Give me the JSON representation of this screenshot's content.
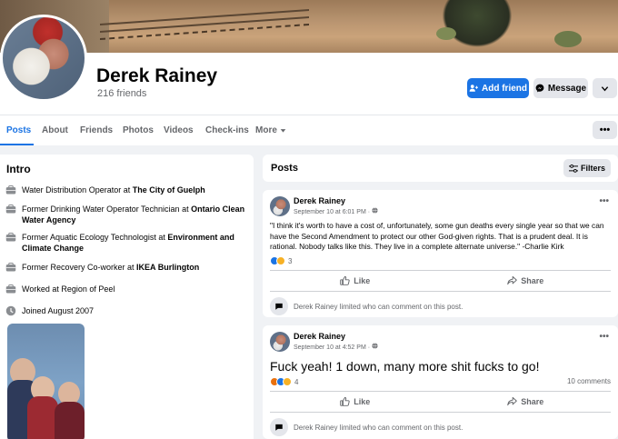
{
  "profile": {
    "name": "Derek Rainey",
    "friends_count": "216 friends"
  },
  "actions": {
    "add_friend": "Add friend",
    "message": "Message"
  },
  "tabs": [
    {
      "label": "Posts"
    },
    {
      "label": "About"
    },
    {
      "label": "Friends"
    },
    {
      "label": "Photos"
    },
    {
      "label": "Videos"
    },
    {
      "label": "Check-ins"
    },
    {
      "label": "More"
    }
  ],
  "intro": {
    "title": "Intro",
    "items": [
      {
        "pre": "Water Distribution Operator at ",
        "bold": "The City of Guelph",
        "icon": "briefcase-icon"
      },
      {
        "pre": "Former Drinking Water Operator Technician at ",
        "bold": "Ontario Clean Water Agency",
        "icon": "briefcase-icon"
      },
      {
        "pre": "Former Aquatic Ecology Technologist at ",
        "bold": "Environment and Climate Change",
        "icon": "briefcase-icon"
      },
      {
        "pre": "Former Recovery Co-worker at ",
        "bold": "IKEA Burlington",
        "icon": "briefcase-icon"
      },
      {
        "pre": "Worked at Region of Peel",
        "bold": "",
        "icon": "briefcase-icon"
      },
      {
        "pre": "Joined August 2007",
        "bold": "",
        "icon": "clock-icon"
      }
    ]
  },
  "posts_header": {
    "title": "Posts",
    "filters_label": "Filters"
  },
  "posts": [
    {
      "author": "Derek Rainey",
      "date": "September 10 at 6:01 PM · ",
      "text": "\"I think it's worth to have a cost of, unfortunately, some gun deaths every single year so that we can have the Second Amendment to protect our other God-given rights. That is a prudent deal. It is rational. Nobody talks like this. They live in a complete alternate universe.\" -Charlie Kirk",
      "reaction_count": "3",
      "comments": "",
      "like_label": "Like",
      "share_label": "Share",
      "limited_text": "Derek Rainey limited who can comment on this post."
    },
    {
      "author": "Derek Rainey",
      "date": "September 10 at 4:52 PM · ",
      "text": "Fuck yeah! 1 down, many more shit fucks to go!",
      "reaction_count": "4",
      "comments": "10 comments",
      "like_label": "Like",
      "share_label": "Share",
      "limited_text": "Derek Rainey limited who can comment on this post."
    }
  ],
  "colors": {
    "accent": "#1b74e4",
    "background": "#f0f2f5",
    "secondary_text": "#65676b"
  }
}
